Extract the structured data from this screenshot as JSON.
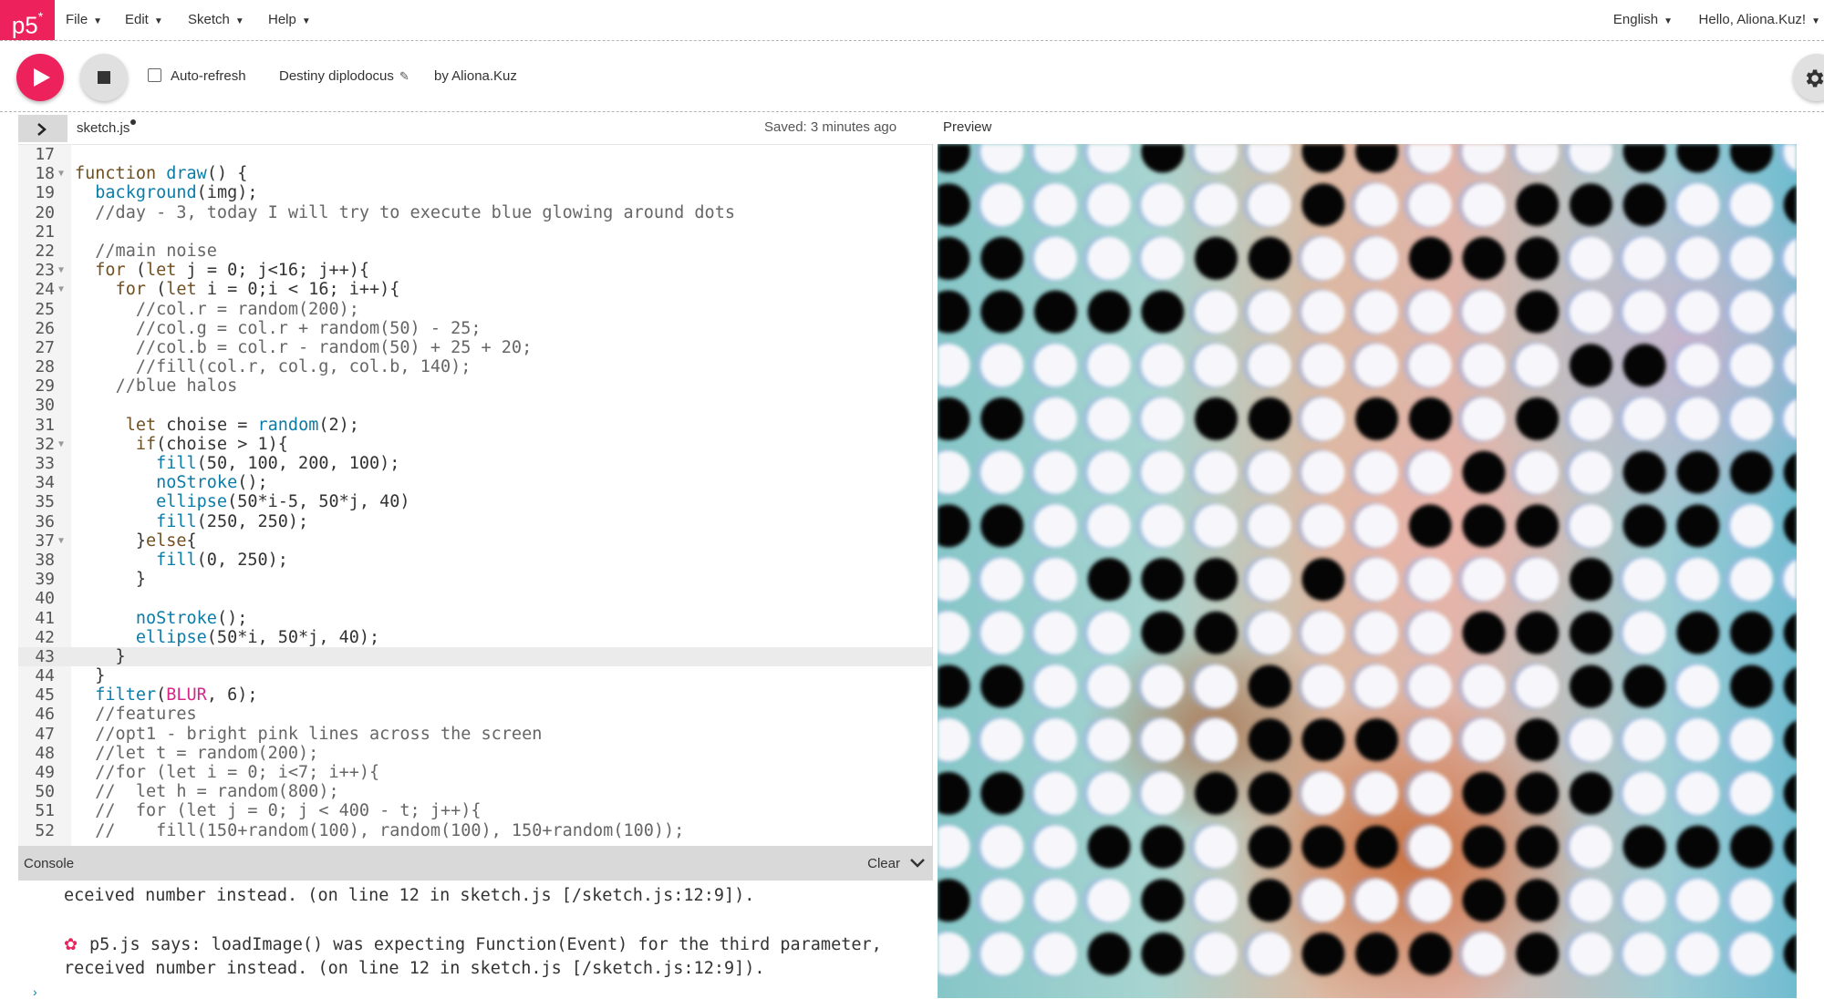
{
  "nav": {
    "logo_text": "p5",
    "logo_star": "*",
    "menus": [
      "File",
      "Edit",
      "Sketch",
      "Help"
    ],
    "language": "English",
    "greeting": "Hello, Aliona.Kuz!"
  },
  "toolbar": {
    "auto_refresh_label": "Auto-refresh",
    "auto_refresh_checked": false,
    "sketch_name": "Destiny diplodocus",
    "owner": "by Aliona.Kuz"
  },
  "editor": {
    "file_name": "sketch.js",
    "saved_status": "Saved: 3 minutes ago",
    "preview_label": "Preview",
    "first_line": "17",
    "active_line": 43,
    "lines": [
      {
        "n": "17",
        "text": ""
      },
      {
        "n": "18",
        "text": "function draw() {",
        "fold": true
      },
      {
        "n": "19",
        "text": "  background(img);"
      },
      {
        "n": "20",
        "text": "  //day - 3, today I will try to execute blue glowing around dots"
      },
      {
        "n": "21",
        "text": ""
      },
      {
        "n": "22",
        "text": "  //main noise"
      },
      {
        "n": "23",
        "text": "  for (let j = 0; j<16; j++){",
        "fold": true
      },
      {
        "n": "24",
        "text": "    for (let i = 0;i < 16; i++){",
        "fold": true
      },
      {
        "n": "25",
        "text": "      //col.r = random(200);"
      },
      {
        "n": "26",
        "text": "      //col.g = col.r + random(50) - 25;"
      },
      {
        "n": "27",
        "text": "      //col.b = col.r - random(50) + 25 + 20;"
      },
      {
        "n": "28",
        "text": "      //fill(col.r, col.g, col.b, 140);"
      },
      {
        "n": "29",
        "text": "    //blue halos"
      },
      {
        "n": "30",
        "text": ""
      },
      {
        "n": "31",
        "text": "     let choise = random(2);"
      },
      {
        "n": "32",
        "text": "      if(choise > 1){",
        "fold": true
      },
      {
        "n": "33",
        "text": "        fill(50, 100, 200, 100);"
      },
      {
        "n": "34",
        "text": "        noStroke();"
      },
      {
        "n": "35",
        "text": "        ellipse(50*i-5, 50*j, 40)"
      },
      {
        "n": "36",
        "text": "        fill(250, 250);"
      },
      {
        "n": "37",
        "text": "      }else{",
        "fold": true
      },
      {
        "n": "38",
        "text": "        fill(0, 250);"
      },
      {
        "n": "39",
        "text": "      }"
      },
      {
        "n": "40",
        "text": ""
      },
      {
        "n": "41",
        "text": "      noStroke();"
      },
      {
        "n": "42",
        "text": "      ellipse(50*i, 50*j, 40);"
      },
      {
        "n": "43",
        "text": "    }"
      },
      {
        "n": "44",
        "text": "  }"
      },
      {
        "n": "45",
        "text": "  filter(BLUR, 6);"
      },
      {
        "n": "46",
        "text": "  //features"
      },
      {
        "n": "47",
        "text": "  //opt1 - bright pink lines across the screen"
      },
      {
        "n": "48",
        "text": "  //let t = random(200);"
      },
      {
        "n": "49",
        "text": "  //for (let i = 0; i<7; i++){"
      },
      {
        "n": "50",
        "text": "  //  let h = random(800);"
      },
      {
        "n": "51",
        "text": "  //  for (let j = 0; j < 400 - t; j++){"
      },
      {
        "n": "52",
        "text": "  //    fill(150+random(100), random(100), 150+random(100));"
      }
    ]
  },
  "console": {
    "title": "Console",
    "clear_label": "Clear",
    "message_1_tail": "eceived number instead. (on line 12 in sketch.js [/sketch.js:12:9]).",
    "message_2": "p5.js says: loadImage() was expecting Function(Event) for the third parameter, received number instead. (on line 12 in sketch.js [/sketch.js:12:9]).",
    "prompt": "›"
  },
  "colors": {
    "accent": "#ed225d",
    "keyword": "#704f21",
    "function": "#0b7ca9",
    "builtin_constant": "#d52889",
    "comment": "#666666"
  },
  "preview": {
    "dot_rows": [
      "BWWWBWWBBWWWWBBBW",
      "BWWWWWWBWWWBBBWWB",
      "BBWWWBBWWBBBWWWWW",
      "BBBBBWWWWWWBWWWWW",
      "WWWWWWWWWWWWBBWWW",
      "BBWWWBBWBBWBWWWWW",
      "WWWWWWWWWWBWWBBBB",
      "BBWWWWWWWBBBWBBWB",
      "WWWBBBWBWWWWBWWWW",
      "WWWWBBWWWWBBBWBBB",
      "BBWWWWBWWWWWBBWBB",
      "WWWWWWBBBWWBWWWWB",
      "BBWWWBBWWWBBBWWWB",
      "WWWBBWBBBWBBWBBBB",
      "BWWWBWBWWWBBWWWWB",
      "WWWBBWWBBBWBWWWWB"
    ]
  }
}
